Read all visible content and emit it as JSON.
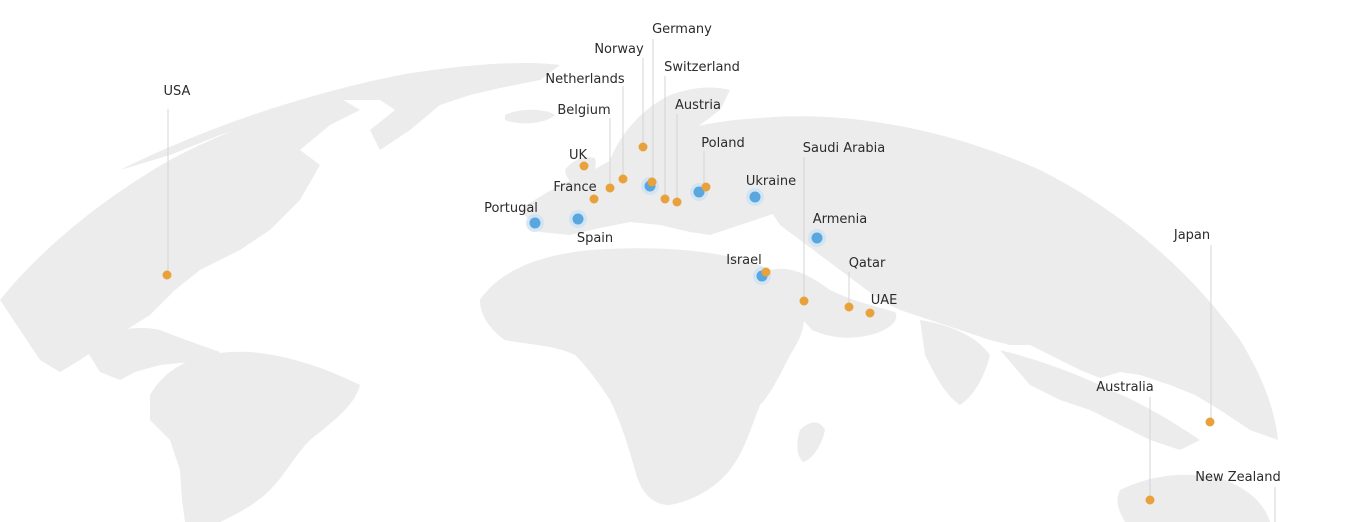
{
  "map": {
    "colors": {
      "land": "#ececec",
      "office_marker": "#5aa6de",
      "client_marker": "#e9a23b",
      "leader_line": "#d4d4d4",
      "label_text": "#2b2b2b"
    },
    "locations": [
      {
        "name": "USA",
        "marker": "orange"
      },
      {
        "name": "Norway",
        "marker": "orange"
      },
      {
        "name": "Germany",
        "marker": "blue+orange"
      },
      {
        "name": "Netherlands",
        "marker": "orange"
      },
      {
        "name": "Switzerland",
        "marker": "orange"
      },
      {
        "name": "Belgium",
        "marker": "orange"
      },
      {
        "name": "Austria",
        "marker": "orange"
      },
      {
        "name": "UK",
        "marker": "orange"
      },
      {
        "name": "Poland",
        "marker": "blue+orange"
      },
      {
        "name": "France",
        "marker": "orange"
      },
      {
        "name": "Portugal",
        "marker": "blue"
      },
      {
        "name": "Spain",
        "marker": "blue"
      },
      {
        "name": "Ukraine",
        "marker": "blue"
      },
      {
        "name": "Saudi Arabia",
        "marker": "orange"
      },
      {
        "name": "Armenia",
        "marker": "blue"
      },
      {
        "name": "Israel",
        "marker": "blue+orange"
      },
      {
        "name": "Qatar",
        "marker": "orange"
      },
      {
        "name": "UAE",
        "marker": "orange"
      },
      {
        "name": "Japan",
        "marker": "orange"
      },
      {
        "name": "Australia",
        "marker": "orange"
      },
      {
        "name": "New Zealand",
        "marker": "orange"
      }
    ]
  }
}
